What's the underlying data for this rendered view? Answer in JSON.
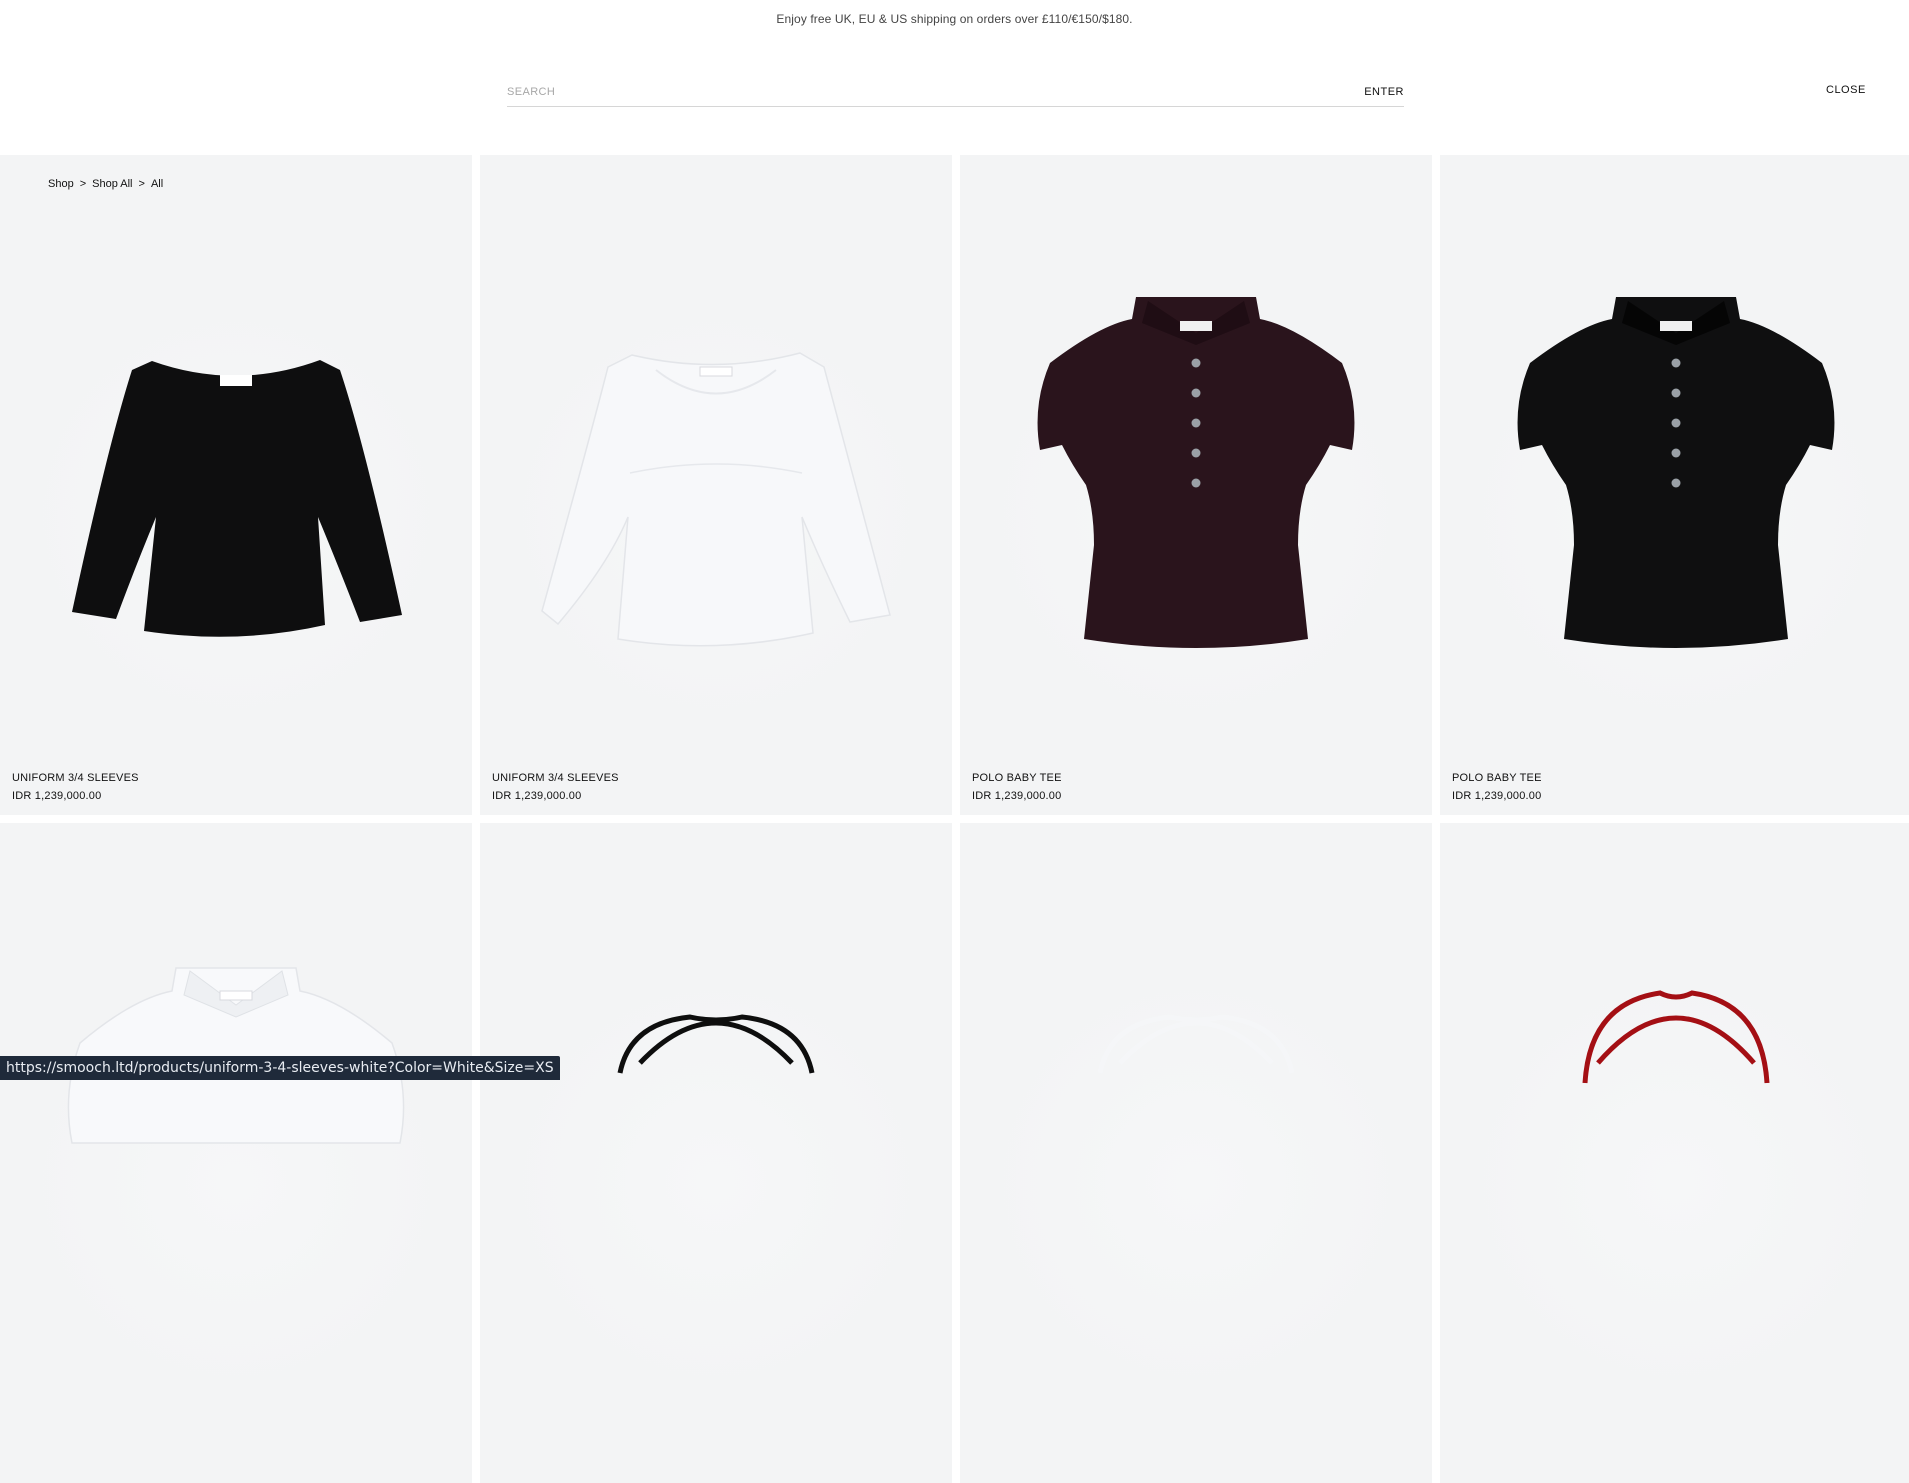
{
  "announcement": "Enjoy free UK, EU & US shipping on orders over £110/€150/$180.",
  "search": {
    "placeholder": "SEARCH",
    "value": "",
    "enter_label": "ENTER"
  },
  "close_label": "CLOSE",
  "breadcrumb": {
    "items": [
      "Shop",
      "Shop All",
      "All"
    ],
    "separator": ">"
  },
  "products": [
    {
      "name": "UNIFORM 3/4 SLEEVES",
      "price": "IDR 1,239,000.00",
      "color": "#0e0e0f",
      "style": "three-quarter-sleeve-top"
    },
    {
      "name": "UNIFORM 3/4 SLEEVES",
      "price": "IDR 1,239,000.00",
      "color": "#f7f8fa",
      "style": "three-quarter-sleeve-top"
    },
    {
      "name": "POLO BABY TEE",
      "price": "IDR 1,239,000.00",
      "color": "#2a141c",
      "style": "polo-baby-tee"
    },
    {
      "name": "POLO BABY TEE",
      "price": "IDR 1,239,000.00",
      "color": "#0f0f10",
      "style": "polo-baby-tee"
    }
  ],
  "second_row": [
    {
      "color": "#f8f9fb",
      "style": "polo-collar-partial"
    },
    {
      "color": "#0e0e0e",
      "style": "halter-strap"
    },
    {
      "color": "#f5f6f8",
      "style": "halter-strap"
    },
    {
      "color": "#a40f14",
      "style": "halter-strap"
    }
  ],
  "status_url": "https://smooch.ltd/products/uniform-3-4-sleeves-white?Color=White&Size=XS"
}
